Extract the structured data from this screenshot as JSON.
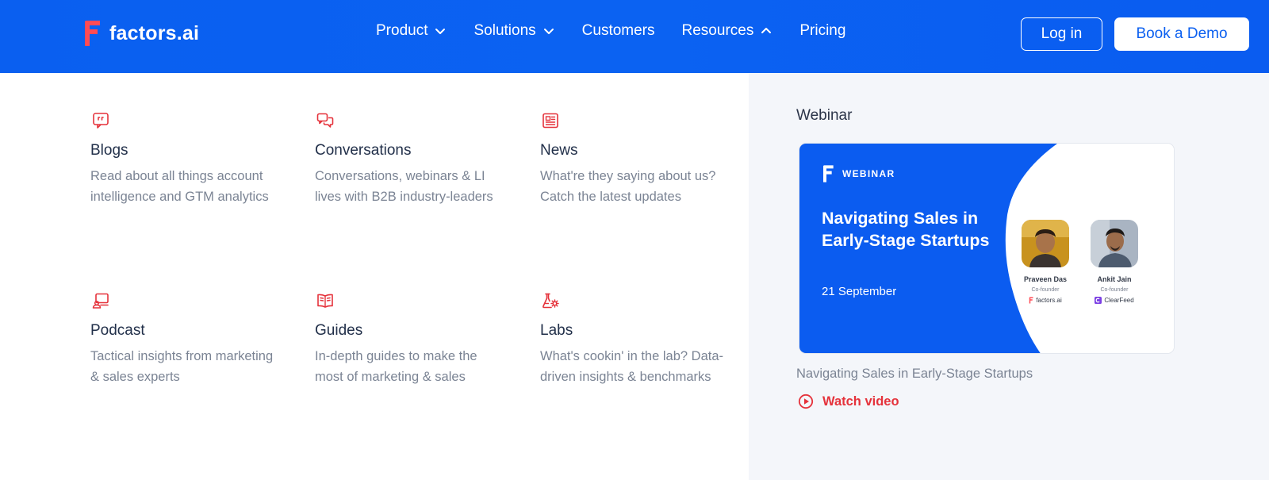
{
  "brand": {
    "name": "factors.ai"
  },
  "nav": {
    "items": [
      {
        "label": "Product",
        "chevron": "down"
      },
      {
        "label": "Solutions",
        "chevron": "down"
      },
      {
        "label": "Customers",
        "chevron": ""
      },
      {
        "label": "Resources",
        "chevron": "up"
      },
      {
        "label": "Pricing",
        "chevron": ""
      }
    ],
    "login_label": "Log in",
    "demo_label": "Book a Demo"
  },
  "resources": [
    {
      "title": "Blogs",
      "description": "Read about all things account intelligence and GTM analytics",
      "icon": "quote-chat-icon"
    },
    {
      "title": "Conversations",
      "description": "Conversations, webinars & LI lives with B2B industry-leaders",
      "icon": "chat-bubbles-icon"
    },
    {
      "title": "News",
      "description": "What're they saying about us? Catch the latest updates",
      "icon": "newspaper-icon"
    },
    {
      "title": "Podcast",
      "description": "Tactical insights from marketing & sales experts",
      "icon": "podcast-icon"
    },
    {
      "title": "Guides",
      "description": "In-depth guides to make the most of marketing & sales",
      "icon": "open-book-icon"
    },
    {
      "title": "Labs",
      "description": "What's cookin' in the lab? Data-driven insights & benchmarks",
      "icon": "flask-gear-icon"
    }
  ],
  "webinar": {
    "section_label": "Webinar",
    "thumb_badge": "WEBINAR",
    "thumb_title": "Navigating Sales in Early-Stage Startups",
    "thumb_date": "21 September",
    "speakers": [
      {
        "name": "Praveen Das",
        "role": "Co-founder",
        "company": "factors.ai"
      },
      {
        "name": "Ankit Jain",
        "role": "Co-founder",
        "company": "ClearFeed"
      }
    ],
    "caption": "Navigating Sales in Early-Stage Startups",
    "watch_label": "Watch video"
  },
  "colors": {
    "header_blue": "#0a5ff0",
    "accent_red": "#e5323b",
    "panel_gray": "#f4f6fa",
    "thumb_blue": "#0a5cf0"
  }
}
